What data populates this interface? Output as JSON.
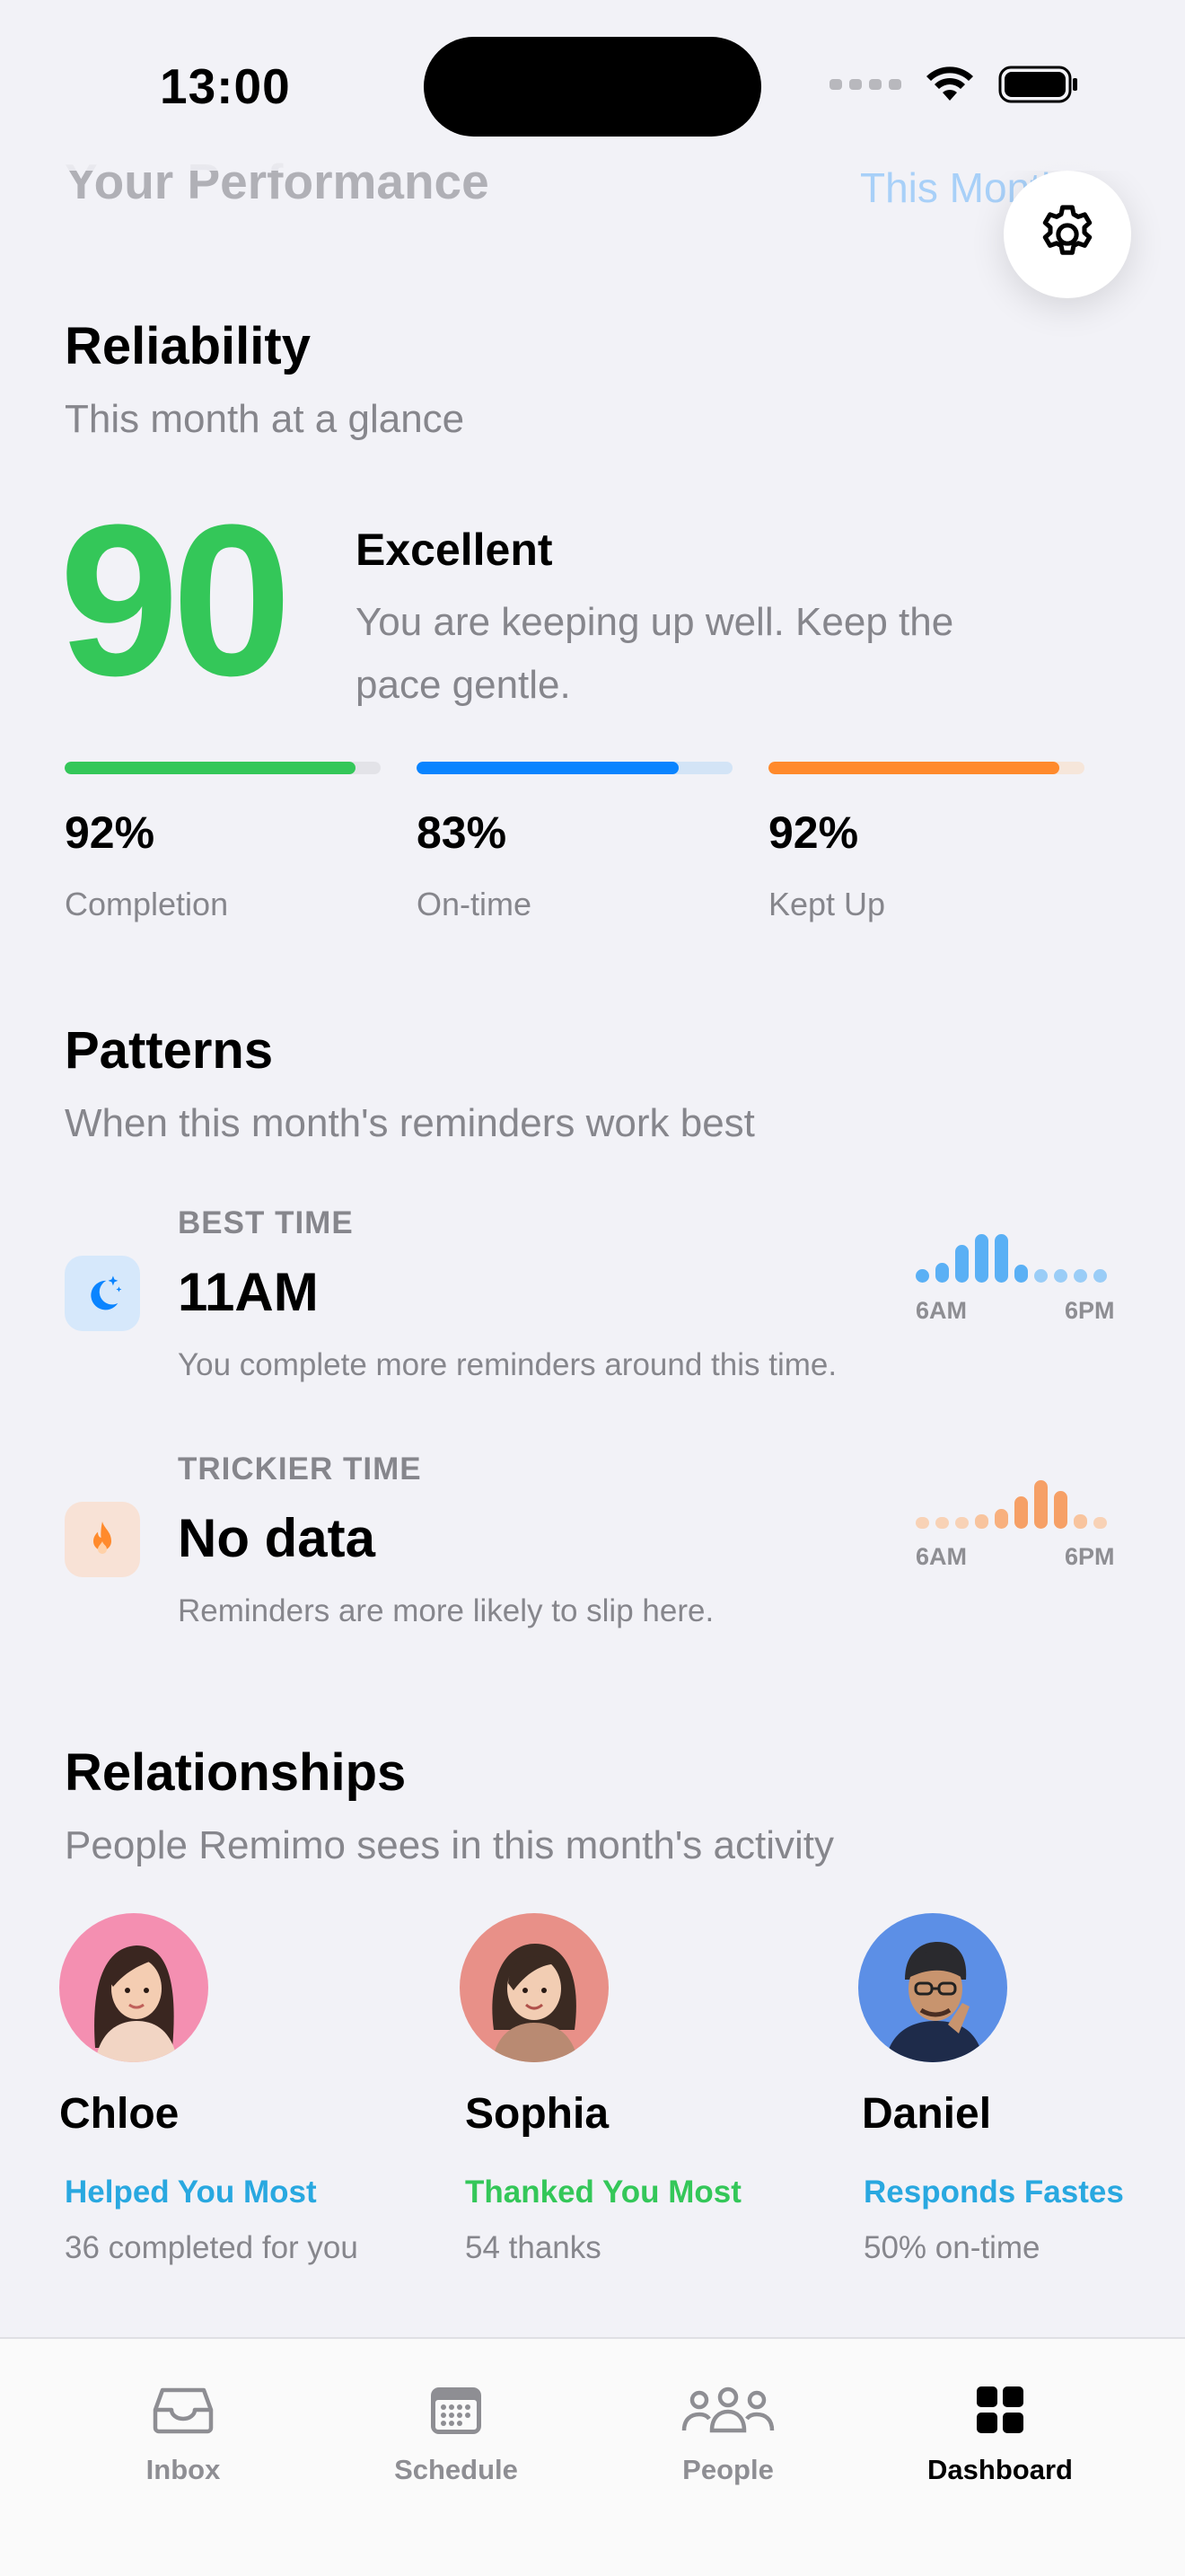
{
  "status_bar": {
    "time": "13:00"
  },
  "header": {
    "title": "Your Performance",
    "period": "This Month"
  },
  "reliability": {
    "title": "Reliability",
    "subtitle": "This month at a glance",
    "score": "90",
    "rating": "Excellent",
    "description": "You are keeping up well. Keep the pace gentle.",
    "metrics": [
      {
        "value": "92%",
        "label": "Completion",
        "fraction": 0.92,
        "color": "#34C759",
        "track": "#E3E3E8"
      },
      {
        "value": "83%",
        "label": "On-time",
        "fraction": 0.83,
        "color": "#0A84FF",
        "track": "#D3E4F6"
      },
      {
        "value": "92%",
        "label": "Kept Up",
        "fraction": 0.92,
        "color": "#FF8A2C",
        "track": "#F6E6DA"
      }
    ]
  },
  "patterns": {
    "title": "Patterns",
    "subtitle": "When this month's reminders work best",
    "items": [
      {
        "kicker": "BEST TIME",
        "value": "11AM",
        "description": "You complete more reminders around this time.",
        "icon": "moon-sparkle-icon",
        "color": "#0A84FF",
        "tick_start": "6AM",
        "tick_end": "6PM"
      },
      {
        "kicker": "TRICKIER TIME",
        "value": "No data",
        "description": "Reminders are more likely to slip here.",
        "icon": "flame-icon",
        "color": "#FF8A2C",
        "tick_start": "6AM",
        "tick_end": "6PM"
      }
    ]
  },
  "relationships": {
    "title": "Relationships",
    "subtitle": "People Remimo sees in this month's activity",
    "people": [
      {
        "name": "Chloe",
        "tag": "Helped You Most",
        "stat": "36 completed for you",
        "tag_color": "#29A8E0",
        "avatar_bg": "#F48FB1"
      },
      {
        "name": "Sophia",
        "tag": "Thanked You Most",
        "stat": "54 thanks",
        "tag_color": "#34C759",
        "avatar_bg": "#E89088"
      },
      {
        "name": "Daniel",
        "tag": "Responds Fastest",
        "stat": "50% on-time",
        "tag_color": "#29A8E0",
        "avatar_bg": "#5C8FE6"
      }
    ]
  },
  "tabbar": {
    "tabs": [
      {
        "label": "Inbox",
        "icon": "inbox-icon"
      },
      {
        "label": "Schedule",
        "icon": "calendar-icon"
      },
      {
        "label": "People",
        "icon": "people-icon"
      },
      {
        "label": "Dashboard",
        "icon": "dashboard-grid-icon",
        "active": true
      }
    ]
  }
}
